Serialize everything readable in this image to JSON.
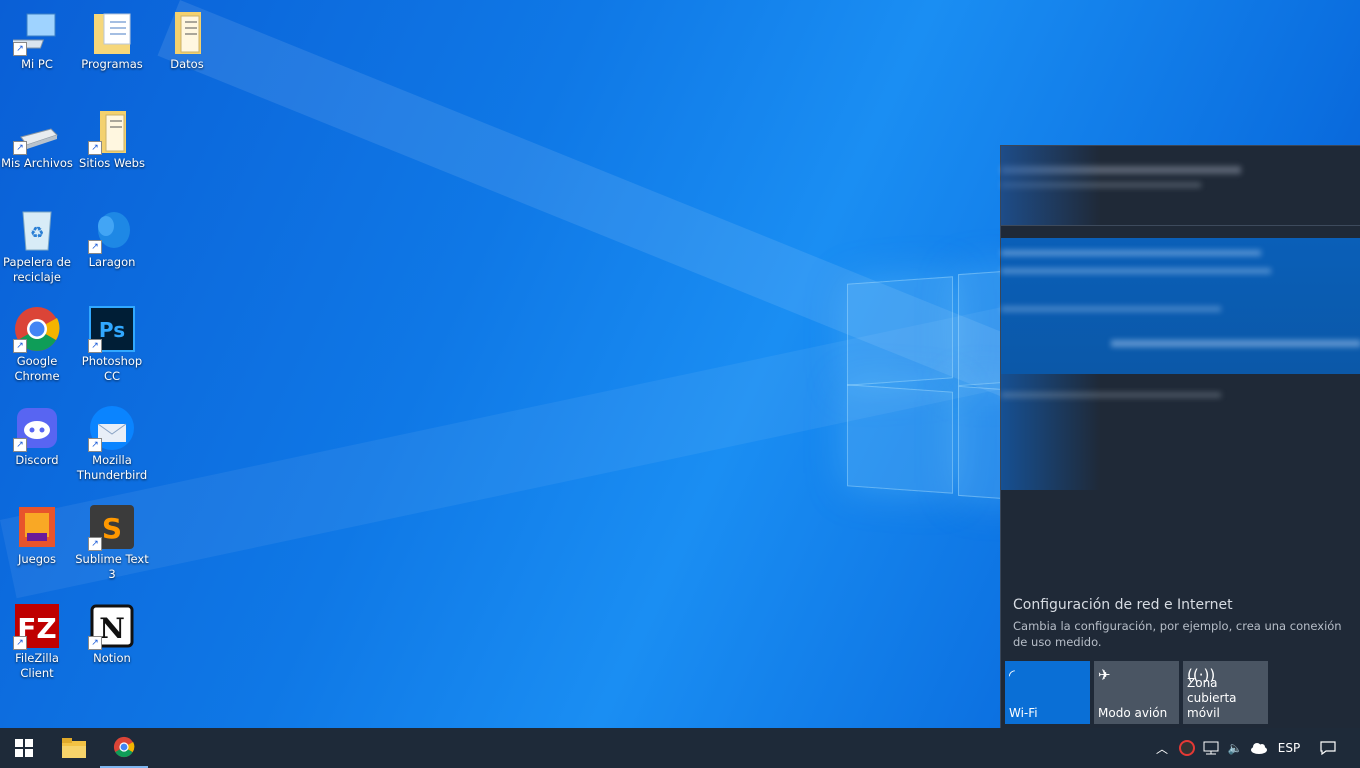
{
  "desktop": {
    "icons": [
      {
        "label": "Mi PC"
      },
      {
        "label": "Programas"
      },
      {
        "label": "Datos"
      },
      {
        "label": "Mis Archivos"
      },
      {
        "label": "Sitios Webs"
      },
      {
        "label": "Papelera de reciclaje"
      },
      {
        "label": "Laragon"
      },
      {
        "label": "Google Chrome"
      },
      {
        "label": "Photoshop CC"
      },
      {
        "label": "Discord"
      },
      {
        "label": "Mozilla Thunderbird"
      },
      {
        "label": "Juegos"
      },
      {
        "label": "Sublime Text 3"
      },
      {
        "label": "FileZilla Client"
      },
      {
        "label": "Notion"
      }
    ]
  },
  "network_flyout": {
    "settings_title": "Configuración de red e Internet",
    "settings_desc": "Cambia la configuración, por ejemplo, crea una conexión de uso medido.",
    "quick_actions": [
      {
        "label": "Wi-Fi",
        "active": true
      },
      {
        "label": "Modo avión",
        "active": false
      },
      {
        "label": "Zona cubierta móvil",
        "active": false
      }
    ]
  },
  "taskbar": {
    "language": "ESP"
  },
  "colors": {
    "accent": "#0a6fd6",
    "taskbar": "#1e2a39",
    "flyout": "#1f2937"
  }
}
